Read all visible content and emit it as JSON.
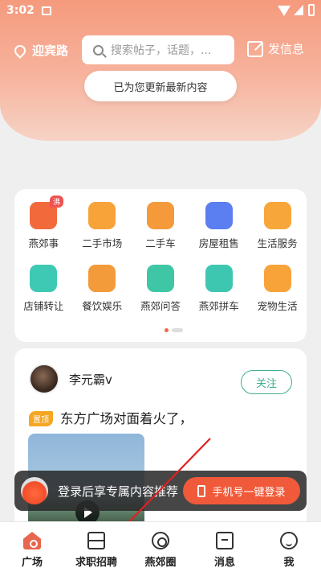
{
  "status_bar": {
    "time": "3:02"
  },
  "header": {
    "location": "迎宾路",
    "search_placeholder": "搜索帖子，话题，...",
    "post_info_label": "发信息",
    "refresh_notice": "已为您更新最新内容"
  },
  "categories": [
    {
      "label": "燕郊事",
      "icon": "fire-icon",
      "color": "#f26a3c",
      "badge": "沸"
    },
    {
      "label": "二手市场",
      "icon": "basket-icon",
      "color": "#f7a33a"
    },
    {
      "label": "二手车",
      "icon": "car-icon",
      "color": "#f59a3b"
    },
    {
      "label": "房屋租售",
      "icon": "building-icon",
      "color": "#5b7ef0"
    },
    {
      "label": "生活服务",
      "icon": "plant-icon",
      "color": "#f7a63a"
    },
    {
      "label": "店铺转让",
      "icon": "shop-icon",
      "color": "#3dc9b3"
    },
    {
      "label": "餐饮娱乐",
      "icon": "utensils-icon",
      "color": "#f39a3a"
    },
    {
      "label": "燕郊问答",
      "icon": "chat-bubble-icon",
      "color": "#3fc7a5"
    },
    {
      "label": "燕郊拼车",
      "icon": "carpool-icon",
      "color": "#3ec7b0"
    },
    {
      "label": "宠物生活",
      "icon": "paw-icon",
      "color": "#f7a33a"
    }
  ],
  "post": {
    "username": "李元霸v",
    "follow_label": "关注",
    "pin_tag": "置顶",
    "title": "东方广场对面着火了，"
  },
  "login_banner": {
    "text": "登录后享专属内容推荐",
    "button_label": "手机号一键登录"
  },
  "tabs": [
    {
      "label": "广场",
      "icon": "home-icon",
      "active": true
    },
    {
      "label": "求职招聘",
      "icon": "briefcase-icon"
    },
    {
      "label": "燕郊圈",
      "icon": "circle-icon"
    },
    {
      "label": "消息",
      "icon": "chat-icon"
    },
    {
      "label": "我",
      "icon": "face-icon"
    }
  ],
  "colors": {
    "accent": "#f05a3a",
    "follow": "#3fae92",
    "header": "#f59a7d"
  }
}
